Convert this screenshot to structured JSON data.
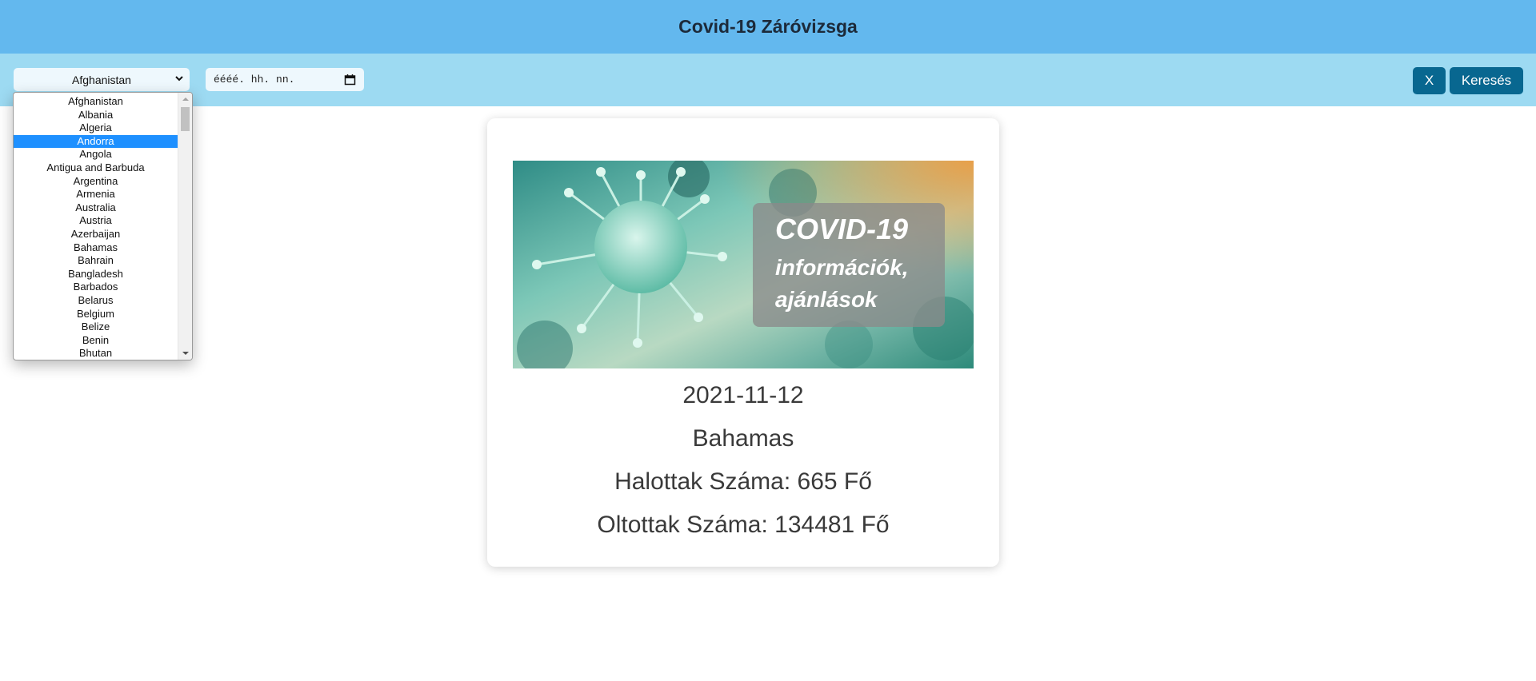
{
  "app": {
    "title": "Covid-19 Záróvizsga"
  },
  "filters": {
    "country_selected": "Afghanistan",
    "date_placeholder": "éééé. hh. nn.",
    "clear_label": "X",
    "search_label": "Keresés"
  },
  "dropdown": {
    "highlighted": "Andorra",
    "options": [
      "Afghanistan",
      "Albania",
      "Algeria",
      "Andorra",
      "Angola",
      "Antigua and Barbuda",
      "Argentina",
      "Armenia",
      "Australia",
      "Austria",
      "Azerbaijan",
      "Bahamas",
      "Bahrain",
      "Bangladesh",
      "Barbados",
      "Belarus",
      "Belgium",
      "Belize",
      "Benin",
      "Bhutan"
    ]
  },
  "card": {
    "banner": {
      "line1": "COVID-19",
      "line2": "információk,",
      "line3": "ajánlások"
    },
    "date": "2021-11-12",
    "country": "Bahamas",
    "deaths_text": "Halottak Száma: 665 Fő",
    "vaccinated_text": "Oltottak Száma: 134481 Fő"
  },
  "colors": {
    "header_bg": "#63b8ee",
    "toolbar_bg": "#9ddaf2",
    "button_bg": "#086790",
    "selected_option": "#1e90ff"
  },
  "icons": {
    "select": "chevron-down-icon",
    "date": "calendar-icon",
    "scroll_up": "scroll-up-arrow-icon",
    "scroll_down": "scroll-down-arrow-icon",
    "banner": "virus-image"
  }
}
